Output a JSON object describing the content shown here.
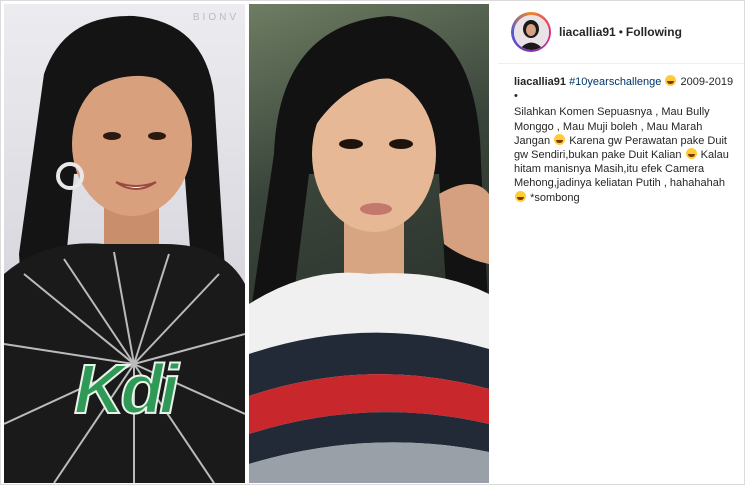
{
  "post": {
    "username": "liacallia91",
    "separator": "•",
    "follow_status": "Following",
    "left_photo_watermark": "BIONV",
    "left_photo_shirt_text": "Kdi",
    "caption": {
      "username": "liacallia91",
      "hashtag": "#10yearschallenge",
      "years": "2009-2019",
      "bullet": "•",
      "body_1": "Silahkan Komen Sepuasnya , Mau Bully Monggo , Mau Muji boleh , Mau Marah Jangan",
      "body_2": "Karena gw Perawatan pake Duit gw Sendiri,bukan pake Duit Kalian",
      "body_3": "Kalau hitam manisnya Masih,itu efek Camera Mehong,jadinya keliatan Putih , hahahahah",
      "body_4": "*sombong"
    }
  }
}
